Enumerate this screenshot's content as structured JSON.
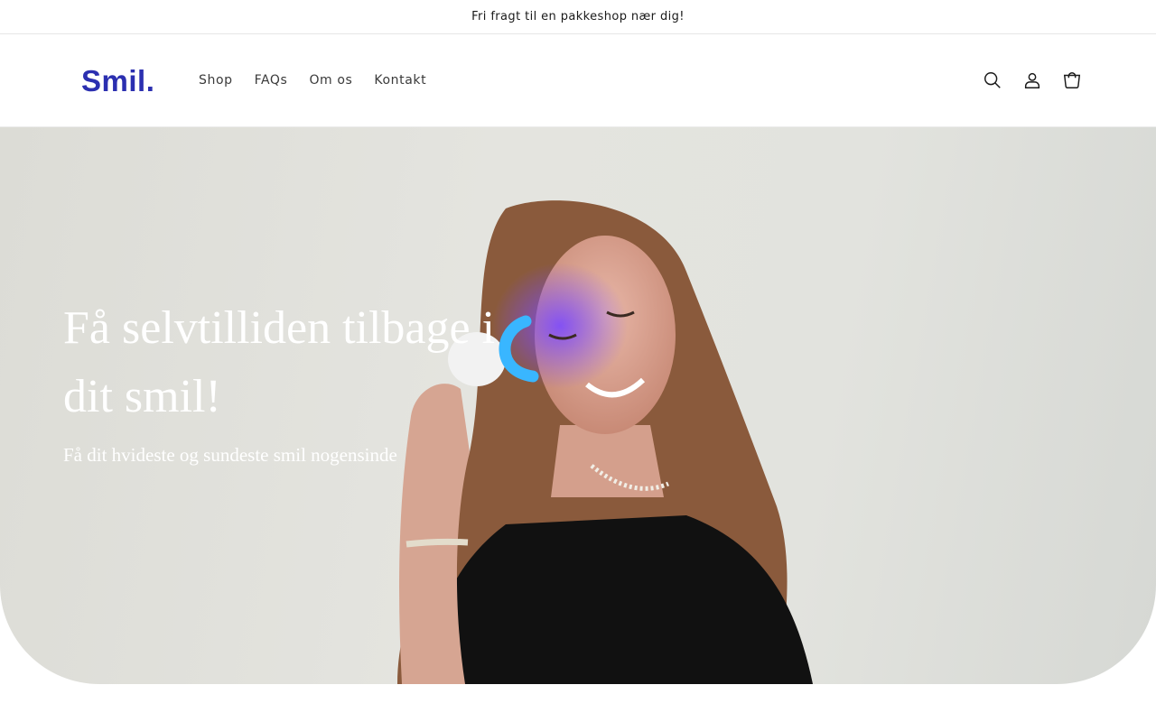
{
  "announcement": {
    "text": "Fri fragt til en pakkeshop nær dig!"
  },
  "header": {
    "logo_text": "Smil.",
    "nav": [
      "Shop",
      "FAQs",
      "Om os",
      "Kontakt"
    ],
    "icons": [
      "search-icon",
      "account-icon",
      "cart-icon"
    ]
  },
  "hero": {
    "title": "Få selvtilliden tilbage i dit smil!",
    "subtitle": "Få dit hvideste og sundeste smil nogensinde"
  },
  "colors": {
    "brand": "#2b2fb0",
    "hero_text": "#ffffff",
    "background": "#ffffff"
  }
}
